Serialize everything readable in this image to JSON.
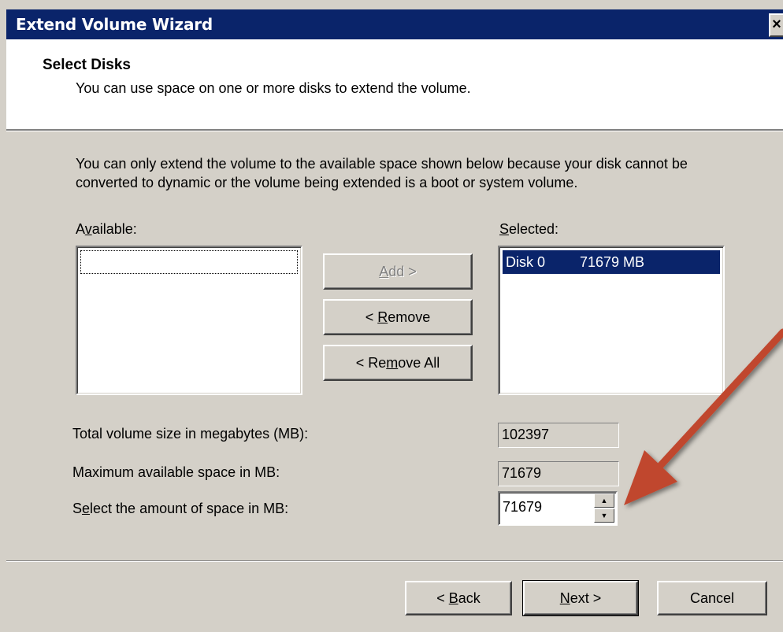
{
  "window": {
    "title": "Extend Volume Wizard",
    "close_label": "×"
  },
  "header": {
    "title": "Select Disks",
    "subtitle": "You can use space on one or more disks to extend the volume."
  },
  "info_text": "You can only extend the volume to the available space shown below because your disk cannot be converted to dynamic or the volume being extended is a boot or system volume.",
  "available": {
    "label_pre": "A",
    "label_acc": "v",
    "label_post": "ailable:",
    "items": []
  },
  "selected": {
    "label_pre": "",
    "label_acc": "S",
    "label_post": "elected:",
    "items": [
      {
        "disk": "Disk 0",
        "size": "71679 MB"
      }
    ]
  },
  "buttons": {
    "add": {
      "pre": "",
      "acc": "A",
      "post": "dd >"
    },
    "remove": {
      "pre": "< ",
      "acc": "R",
      "post": "emove"
    },
    "remove_all": {
      "pre": "< Re",
      "acc": "m",
      "post": "ove All"
    },
    "back": {
      "pre": "< ",
      "acc": "B",
      "post": "ack"
    },
    "next": {
      "pre": "",
      "acc": "N",
      "post": "ext >"
    },
    "cancel": "Cancel"
  },
  "fields": {
    "total_label": "Total volume size in megabytes (MB):",
    "total_value": "102397",
    "max_label": "Maximum available space in MB:",
    "max_value": "71679",
    "amount_label_pre": "S",
    "amount_label_acc": "e",
    "amount_label_post": "lect the amount of space in MB:",
    "amount_value": "71679"
  },
  "icons": {
    "spin_up": "▲",
    "spin_down": "▼"
  },
  "colors": {
    "titlebar": "#0a246a",
    "dialog": "#d4d0c8",
    "selection": "#0a246a",
    "annotation_arrow": "#c0472f"
  }
}
